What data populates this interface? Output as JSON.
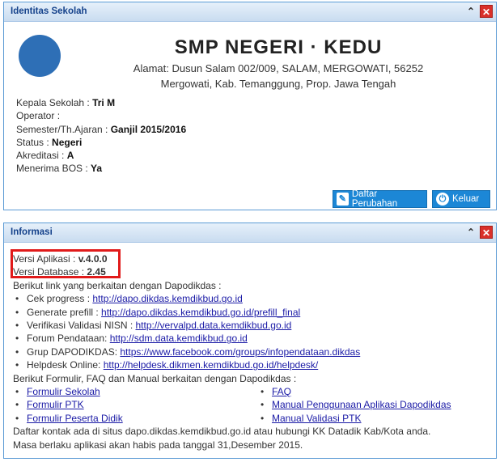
{
  "panel1": {
    "title": "Identitas Sekolah",
    "school_name": "SMP NEGERI · KEDU",
    "address_line1": "Alamat: Dusun Salam 002/009, SALAM, MERGOWATI, 56252",
    "address_line2": "Mergowati, Kab. Temanggung, Prop. Jawa Tengah",
    "rows": [
      {
        "label": "Kepala Sekolah : ",
        "value": "Tri M"
      },
      {
        "label": "Operator : ",
        "value": ""
      },
      {
        "label": "Semester/Th.Ajaran : ",
        "value": "Ganjil 2015/2016"
      },
      {
        "label": "Status : ",
        "value": "Negeri"
      },
      {
        "label": "Akreditasi : ",
        "value": "A"
      },
      {
        "label": "Menerima BOS : ",
        "value": "Ya"
      }
    ],
    "btn_daftar": "Daftar Perubahan",
    "btn_keluar": "Keluar"
  },
  "panel2": {
    "title": "Informasi",
    "versi_aplikasi_label": "Versi Aplikasi : ",
    "versi_aplikasi": "v.4.0.0",
    "versi_db_label": "Versi Database : ",
    "versi_db": "2.45",
    "intro_links": "Berikut link yang berkaitan dengan Dapodikdas :",
    "links": [
      {
        "label": "Cek progress : ",
        "url": "http://dapo.dikdas.kemdikbud.go.id"
      },
      {
        "label": "Generate prefill : ",
        "url": "http://dapo.dikdas.kemdikbud.go.id/prefill_final"
      },
      {
        "label": "Verifikasi Validasi NISN : ",
        "url": "http://vervalpd.data.kemdikbud.go.id"
      },
      {
        "label": "Forum Pendataan: ",
        "url": "http://sdm.data.kemdikbud.go.id"
      },
      {
        "label": "Grup DAPODIKDAS: ",
        "url": "https://www.facebook.com/groups/infopendataan.dikdas"
      },
      {
        "label": "Helpdesk Online: ",
        "url": "http://helpdesk.dikmen.kemdikbud.go.id/helpdesk/"
      }
    ],
    "intro_forms": "Berikut Formulir, FAQ dan Manual berkaitan dengan Dapodikdas :",
    "forms": [
      "Formulir Sekolah",
      "FAQ",
      "Formulir PTK",
      "Manual Penggunaan Aplikasi Dapodikdas",
      "Formulir Peserta Didik",
      "Manual Validasi PTK"
    ],
    "contact": "Daftar kontak ada di situs dapo.dikdas.kemdikbud.go.id atau hubungi KK Datadik Kab/Kota anda.",
    "expiry": "Masa berlaku aplikasi akan habis pada tanggal 31,Desember 2015."
  }
}
